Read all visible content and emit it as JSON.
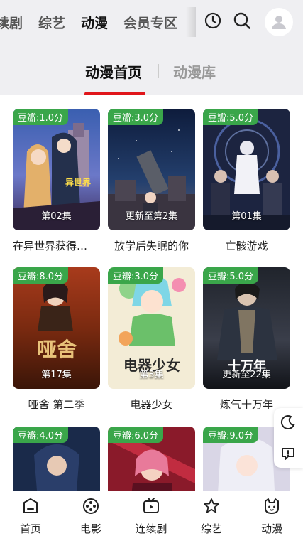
{
  "channels": [
    "续剧",
    "综艺",
    "动漫",
    "会员专区"
  ],
  "active_channel": "动漫",
  "subtabs": {
    "home": "动漫首页",
    "library": "动漫库"
  },
  "cards": [
    {
      "score": "豆瓣:1.0分",
      "episode": "第02集",
      "title": "在异世界获得…",
      "poster_text": "异世界"
    },
    {
      "score": "豆瓣:3.0分",
      "episode": "更新至第2集",
      "title": "放学后失眠的你",
      "poster_text": ""
    },
    {
      "score": "豆瓣:5.0分",
      "episode": "第01集",
      "title": "亡骸游戏",
      "poster_text": ""
    },
    {
      "score": "豆瓣:8.0分",
      "episode": "第17集",
      "title": "哑舍 第二季",
      "poster_text": "哑舍"
    },
    {
      "score": "豆瓣:3.0分",
      "episode": "第3集",
      "title": "电器少女",
      "poster_text": "电器少女"
    },
    {
      "score": "豆瓣:5.0分",
      "episode": "更新至22集",
      "title": "炼气十万年",
      "poster_text": "十万年"
    },
    {
      "score": "豆瓣:4.0分",
      "episode": "",
      "title": "",
      "poster_text": ""
    },
    {
      "score": "豆瓣:6.0分",
      "episode": "",
      "title": "",
      "poster_text": ""
    },
    {
      "score": "豆瓣:9.0分",
      "episode": "",
      "title": "",
      "poster_text": ""
    }
  ],
  "bottom_nav": [
    "首页",
    "电影",
    "连续剧",
    "综艺",
    "动漫"
  ],
  "icons": {
    "history": "clock-icon",
    "search": "search-icon",
    "avatar": "user-avatar-icon",
    "night": "moon-icon",
    "feedback": "feedback-icon"
  },
  "colors": {
    "score_badge": "#3aa64a",
    "tab_indicator": "#e0161b",
    "channel_highlight": "#f5c518"
  }
}
